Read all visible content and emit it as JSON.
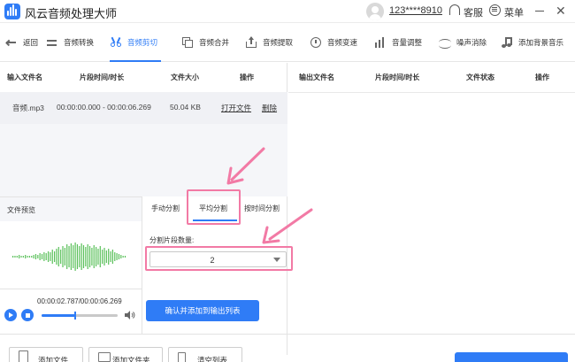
{
  "app": {
    "title": "风云音频处理大师"
  },
  "account": {
    "username": "123****8910",
    "service_label": "客服",
    "menu_label": "菜单"
  },
  "toolbar": {
    "back": "返回",
    "items": [
      "音频转换",
      "音频剪切",
      "音频合并",
      "音频提取",
      "音频变速",
      "音量调整",
      "噪声消除",
      "添加背景音乐"
    ],
    "active_index": 1
  },
  "input_table": {
    "headers": [
      "输入文件名",
      "片段时间/时长",
      "文件大小",
      "操作"
    ],
    "rows": [
      {
        "name": "音频.mp3",
        "time": "00:00:00.000 - 00:00:06.269",
        "size": "50.04 KB",
        "open": "打开文件",
        "delete": "删除"
      }
    ]
  },
  "output_table": {
    "headers": [
      "输出文件名",
      "片段时间/时长",
      "文件状态",
      "操作"
    ]
  },
  "preview": {
    "title": "文件预览",
    "time": "00:00:02.787/00:00:06.269",
    "progress": 0.444
  },
  "split": {
    "tabs": [
      "手动分割",
      "平均分割",
      "按时间分割"
    ],
    "active_tab": 1,
    "segment_label": "分割片段数量:",
    "segment_value": "2",
    "confirm_label": "确认并添加到输出列表"
  },
  "bottom": {
    "add_file": "添加文件",
    "add_folder": "添加文件夹",
    "clear_list": "清空列表"
  },
  "colors": {
    "accent": "#2f7cf6",
    "annotation": "#f27aa5",
    "wave": "#5ac05a"
  }
}
